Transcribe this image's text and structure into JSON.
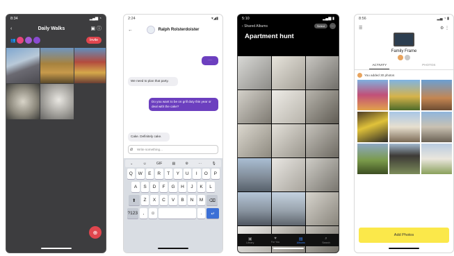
{
  "screen1": {
    "time": "8:34",
    "title": "Daily Walks",
    "back_icon": "chevron-left",
    "invite_label": "Invite",
    "avatar_colors": [
      "#e6467c",
      "#a35ad6",
      "#8a4bd1"
    ],
    "photo_count": 5
  },
  "screen2": {
    "time": "2:24",
    "contact": "Ralph Rolsterdoister",
    "messages": [
      {
        "from": "out",
        "text": "····"
      },
      {
        "from": "in",
        "text": "We need to plan that party."
      },
      {
        "from": "out",
        "text": "Do you want to be on grill duty this year or deal with the cake?"
      },
      {
        "from": "in",
        "text": "Cake. Definitely cake."
      }
    ],
    "composer_placeholder": "Write something...",
    "keyboard_toolbar": [
      "GIF"
    ],
    "keyboard_rows": [
      [
        "Q",
        "W",
        "E",
        "R",
        "T",
        "Y",
        "U",
        "I",
        "O",
        "P"
      ],
      [
        "A",
        "S",
        "D",
        "F",
        "G",
        "H",
        "J",
        "K",
        "L"
      ],
      [
        "Z",
        "X",
        "C",
        "V",
        "B",
        "N",
        "M"
      ]
    ],
    "mode_key": "?123",
    "comma_key": ","
  },
  "screen3": {
    "time": "5:10",
    "back_label": "Shared Albums",
    "album_title": "Apartment hunt",
    "select_label": "Select",
    "tabs": [
      "Library",
      "For You",
      "Albums",
      "Search"
    ],
    "active_tab": "Albums"
  },
  "screen4": {
    "time": "8:56",
    "title": "Family Frame",
    "tabs": [
      "ACTIVITY",
      "PHOTOS"
    ],
    "activity_text": "You added 30 photos",
    "add_button": "Add Photos"
  }
}
